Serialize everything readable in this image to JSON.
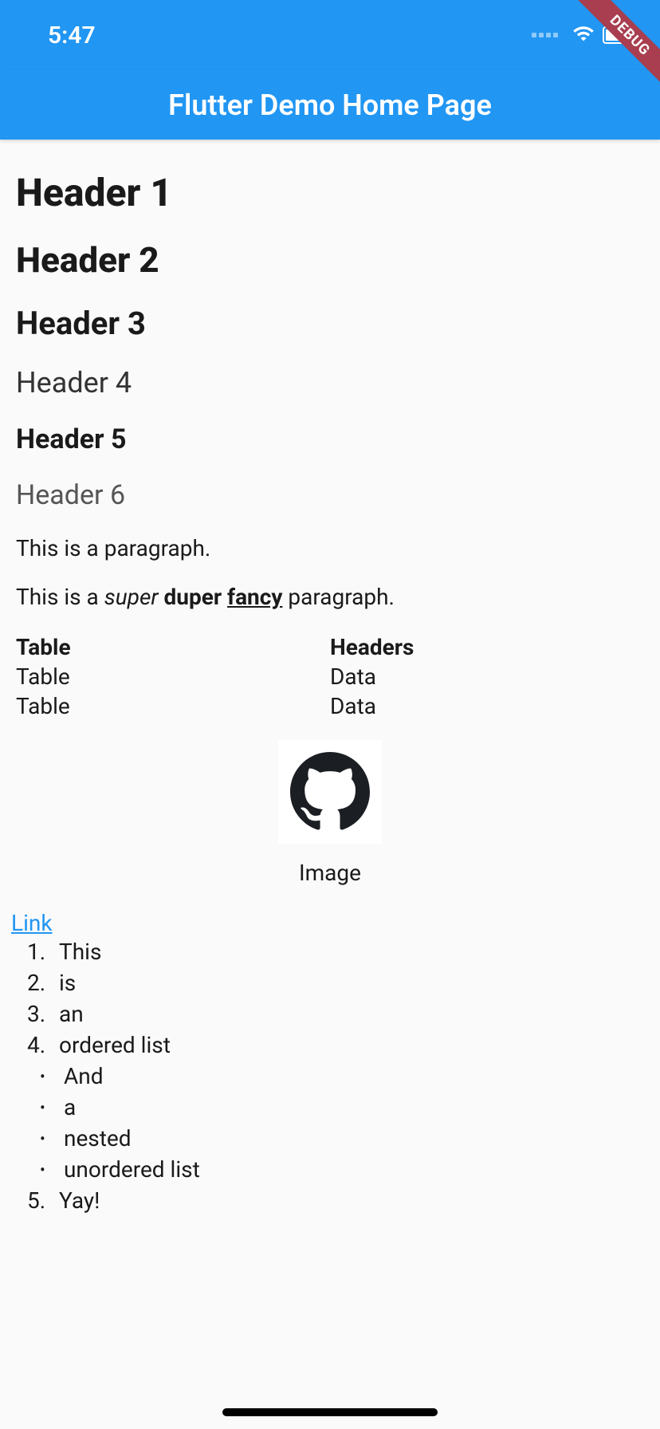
{
  "statusBar": {
    "time": "5:47"
  },
  "debugBanner": "DEBUG",
  "appBar": {
    "title": "Flutter Demo Home Page"
  },
  "headers": {
    "h1": "Header 1",
    "h2": "Header 2",
    "h3": "Header 3",
    "h4": "Header 4",
    "h5": "Header 5",
    "h6": "Header 6"
  },
  "paragraphs": {
    "p1": "This is a paragraph.",
    "p2_prefix": "This is a ",
    "p2_italic": "super",
    "p2_space1": " ",
    "p2_bold": "duper",
    "p2_space2": " ",
    "p2_underline": "fancy",
    "p2_suffix": " paragraph."
  },
  "table": {
    "headers": [
      "Table",
      "Headers"
    ],
    "rows": [
      [
        "Table",
        "Data"
      ],
      [
        "Table",
        "Data"
      ]
    ]
  },
  "image": {
    "caption": "Image"
  },
  "link": {
    "text": "Link"
  },
  "orderedList": [
    "This",
    "is",
    "an",
    "ordered list"
  ],
  "unorderedList": [
    "And",
    "a",
    "nested",
    "unordered list"
  ],
  "orderedListEnd": [
    "Yay!"
  ]
}
